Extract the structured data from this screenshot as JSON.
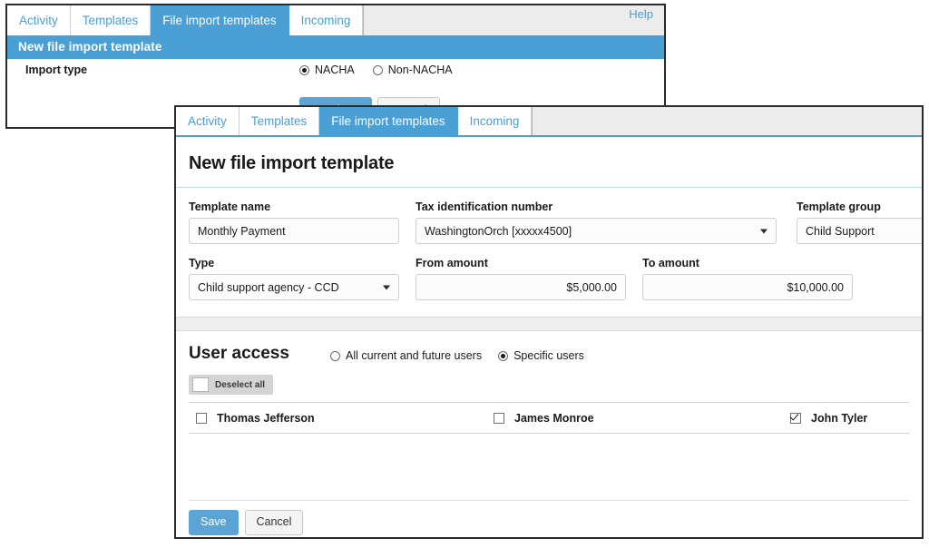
{
  "back_window": {
    "tabs": [
      {
        "label": "Activity",
        "active": false
      },
      {
        "label": "Templates",
        "active": false
      },
      {
        "label": "File import templates",
        "active": true
      },
      {
        "label": "Incoming",
        "active": false
      }
    ],
    "help_label": "Help",
    "header_title": "New file import template",
    "import_type_label": "Import type",
    "import_type_options": [
      {
        "label": "NACHA",
        "selected": true
      },
      {
        "label": "Non-NACHA",
        "selected": false
      }
    ],
    "continue_label": "Continue",
    "cancel_label": "Cancel"
  },
  "front_window": {
    "tabs": [
      {
        "label": "Activity",
        "active": false
      },
      {
        "label": "Templates",
        "active": false
      },
      {
        "label": "File import templates",
        "active": true
      },
      {
        "label": "Incoming",
        "active": false
      }
    ],
    "page_title": "New file import template",
    "fields": {
      "template_name": {
        "label": "Template name",
        "value": "Monthly Payment",
        "placeholder": ""
      },
      "tax_id": {
        "label": "Tax identification number",
        "value": "WashingtonOrch [xxxxx4500]"
      },
      "template_group": {
        "label": "Template group",
        "value": "Child Support"
      },
      "type": {
        "label": "Type",
        "value": "Child support agency - CCD"
      },
      "from_amount": {
        "label": "From amount",
        "value": "$5,000.00"
      },
      "to_amount": {
        "label": "To amount",
        "value": "$10,000.00"
      }
    },
    "user_access": {
      "title": "User access",
      "options": [
        {
          "label": "All current and future users",
          "selected": false
        },
        {
          "label": "Specific users",
          "selected": true
        }
      ],
      "deselect_all_label": "Deselect all",
      "users": [
        {
          "name": "Thomas Jefferson",
          "checked": false
        },
        {
          "name": "James Monroe",
          "checked": false
        },
        {
          "name": "John Tyler",
          "checked": true
        }
      ]
    },
    "save_label": "Save",
    "cancel_label": "Cancel"
  },
  "colors": {
    "accent_blue": "#4a9fd4",
    "button_blue": "#5ba4d6",
    "tab_text_blue": "#4a9fd4",
    "divider_gray": "#eeeeee",
    "deselect_gray": "#d4d4d4"
  }
}
